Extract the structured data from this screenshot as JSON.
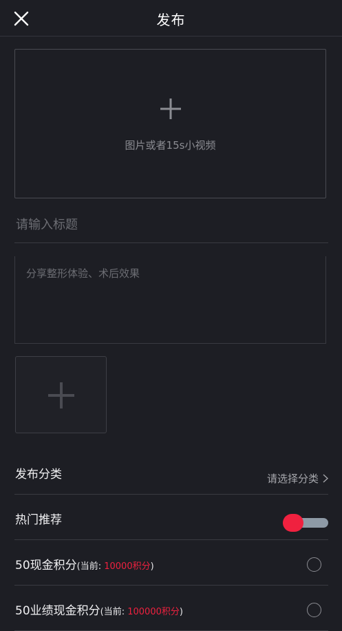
{
  "header": {
    "title": "发布",
    "close_icon": "close-icon"
  },
  "upload": {
    "icon": "plus-icon",
    "hint": "图片或者15s小视频"
  },
  "title_field": {
    "placeholder": "请输入标题",
    "value": ""
  },
  "content_field": {
    "placeholder": "分享整形体验、术后效果",
    "value": ""
  },
  "image_add": {
    "icon": "plus-icon"
  },
  "category": {
    "label": "发布分类",
    "value": "请选择分类",
    "icon": "chevron-right-icon"
  },
  "hot": {
    "label": "热门推荐",
    "toggle_on": true,
    "toggle_color": "#f0213f",
    "track_color": "#8e9aa6"
  },
  "options": [
    {
      "main": "50现金积分",
      "paren_open": "(当前: ",
      "value": "10000积分",
      "paren_close": ")"
    },
    {
      "main": "50业绩现金积分",
      "paren_open": "(当前: ",
      "value": "100000积分",
      "paren_close": ")"
    }
  ],
  "colors": {
    "background": "#1d1e24",
    "accent": "#f0213f",
    "divider": "#3a3b42"
  }
}
